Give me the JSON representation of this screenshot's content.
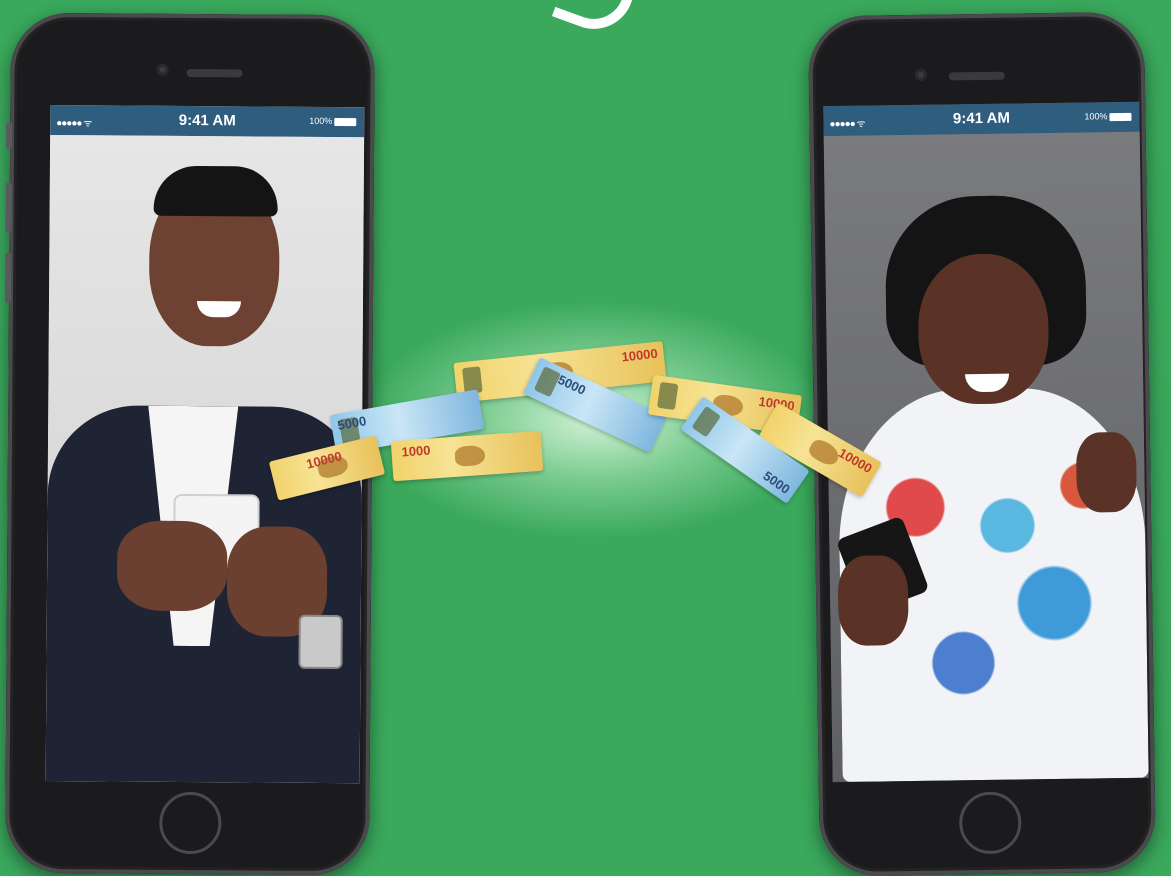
{
  "left_phone": {
    "status": {
      "signal": "●●●●● ᯤ",
      "time": "9:41 AM",
      "battery": "100%"
    }
  },
  "right_phone": {
    "status": {
      "signal": "●●●●● ᯤ",
      "time": "9:41 AM",
      "battery": "100%"
    }
  },
  "banknotes": [
    {
      "denomination": "10000"
    },
    {
      "denomination": "5000"
    },
    {
      "denomination": "10000"
    },
    {
      "denomination": "1000"
    },
    {
      "denomination": "5000"
    },
    {
      "denomination": "10000"
    },
    {
      "denomination": "10000"
    },
    {
      "denomination": "5000"
    }
  ],
  "colors": {
    "background": "#3aa95c",
    "status_bar": "#2f5d7e",
    "note_yellow": "#f2d36b",
    "note_blue": "#8fc6e8"
  }
}
